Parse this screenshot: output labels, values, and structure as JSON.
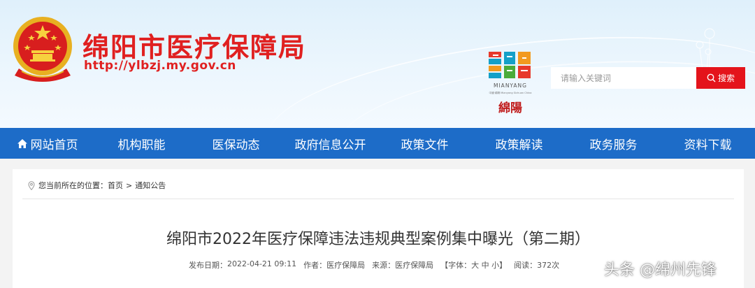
{
  "header": {
    "site_title": "绵阳市医疗保障局",
    "site_url": "http://ylbzj.my.gov.cn",
    "city_logo_pinyin": "MIANYANG",
    "city_logo_small": "中國·綿陽 Mianyang Sichuan China",
    "city_logo_chinese": "綿陽",
    "brand_red": "#e02020"
  },
  "search": {
    "placeholder": "请输入关键词",
    "button_label": "搜索",
    "button_color": "#e4141b"
  },
  "nav": {
    "color": "#1d6cc8",
    "items": [
      {
        "label": "网站首页",
        "icon": "home-icon"
      },
      {
        "label": "机构职能"
      },
      {
        "label": "医保动态"
      },
      {
        "label": "政府信息公开"
      },
      {
        "label": "政策文件"
      },
      {
        "label": "政策解读"
      },
      {
        "label": "政务服务"
      },
      {
        "label": "资料下载"
      }
    ]
  },
  "breadcrumb": {
    "prefix": "您当前所在的位置：",
    "items": [
      "首页",
      "通知公告"
    ],
    "separator": ">"
  },
  "article": {
    "title": "绵阳市2022年医疗保障违法违规典型案例集中曝光（第二期）",
    "publish_label": "发布日期：",
    "publish_date": "2022-04-21 09:11",
    "author_label": "作者：",
    "author": "医疗保障局",
    "source_label": "来源：",
    "source": "医疗保障局",
    "font_label": "【字体：",
    "font_large": "大",
    "font_medium": "中",
    "font_small": "小",
    "font_close": "】",
    "views_label": "阅读：",
    "views": "372次"
  },
  "watermark": "头条 @绵州先锋"
}
